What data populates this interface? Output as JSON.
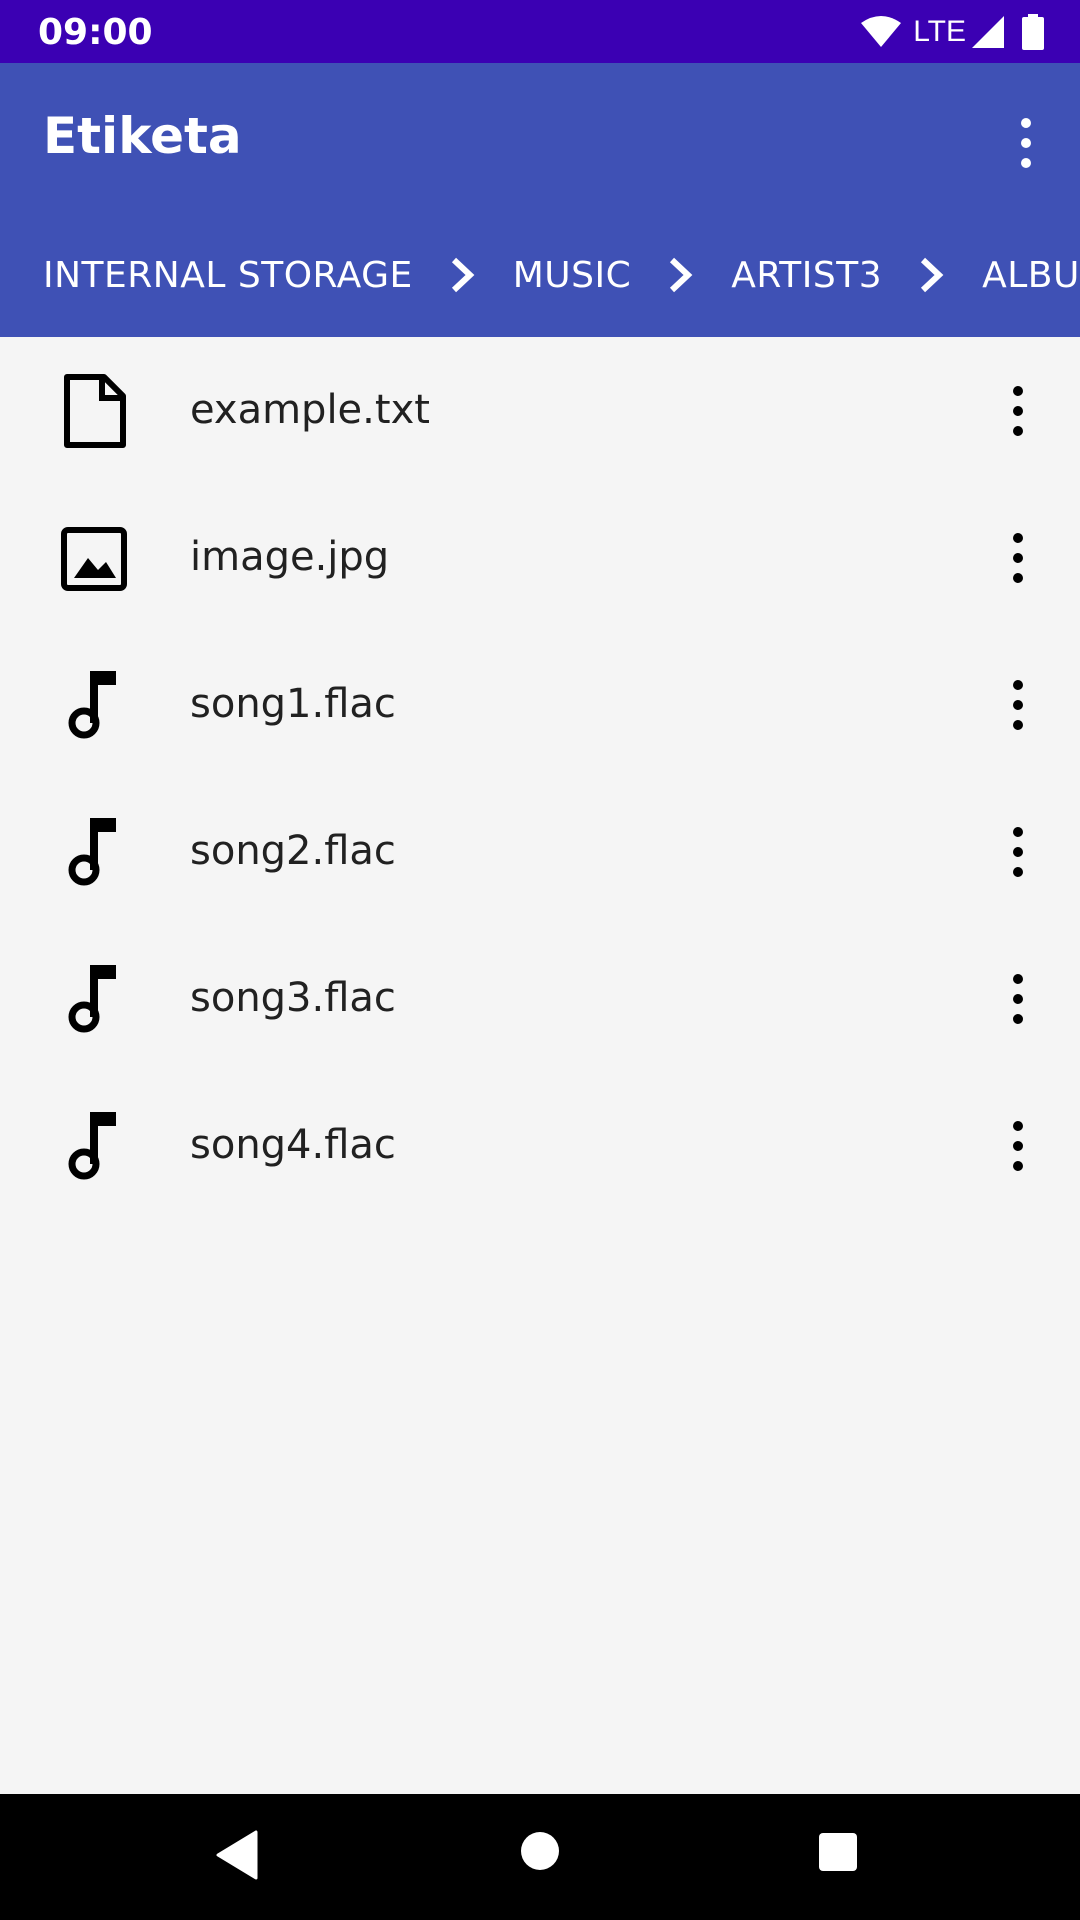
{
  "status_bar": {
    "time": "09:00",
    "network": "LTE",
    "icons": [
      "wifi-icon",
      "signal-icon",
      "battery-icon"
    ]
  },
  "app_bar": {
    "title": "Etiketa",
    "menu_icon": "more-vert-icon"
  },
  "breadcrumb": [
    {
      "label": "INTERNAL STORAGE"
    },
    {
      "label": "MUSIC"
    },
    {
      "label": "ARTIST3"
    },
    {
      "label": "ALBU"
    }
  ],
  "files": [
    {
      "name": "example.txt",
      "icon": "file-icon"
    },
    {
      "name": "image.jpg",
      "icon": "image-icon"
    },
    {
      "name": "song1.flac",
      "icon": "music-note-icon"
    },
    {
      "name": "song2.flac",
      "icon": "music-note-icon"
    },
    {
      "name": "song3.flac",
      "icon": "music-note-icon"
    },
    {
      "name": "song4.flac",
      "icon": "music-note-icon"
    }
  ],
  "nav_bar": {
    "icons": [
      "back-icon",
      "home-icon",
      "recents-icon"
    ]
  },
  "colors": {
    "status_bar": "#3b00b3",
    "app_bar": "#3f51b5",
    "background": "#f5f5f5",
    "text": "#212121"
  }
}
